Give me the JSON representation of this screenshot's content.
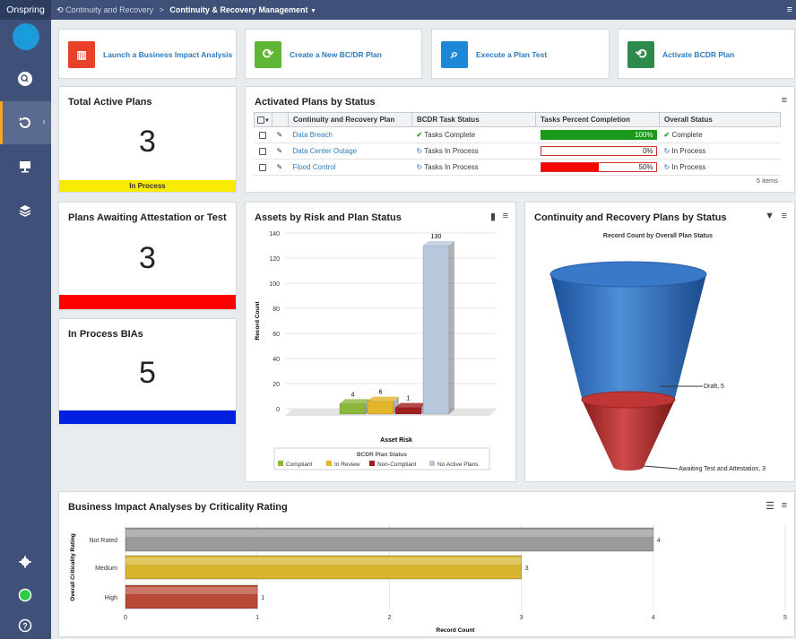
{
  "app": {
    "logo": "Onspring"
  },
  "breadcrumb": {
    "parent": "Continuity and Recovery",
    "separator": ">",
    "current": "Continuity & Recovery Management"
  },
  "nav": {
    "items": [
      "search-icon",
      "continuity-icon",
      "presentation-icon",
      "layers-icon",
      "gear-icon",
      "status-icon",
      "help-icon"
    ]
  },
  "actions": [
    {
      "label": "Launch a Business Impact Analysis",
      "color": "#e8402a"
    },
    {
      "label": "Create a New BC/DR Plan",
      "color": "#5fb534"
    },
    {
      "label": "Execute a Plan Test",
      "color": "#1e87d6"
    },
    {
      "label": "Activate BCDR Plan",
      "color": "#2e8a4a"
    }
  ],
  "stats": {
    "total_active": {
      "title": "Total Active Plans",
      "value": "3",
      "bar_label": "In Process",
      "bar_color": "#f7ec00"
    },
    "awaiting": {
      "title": "Plans Awaiting Attestation or Test",
      "value": "3",
      "bar_color": "#ff0000"
    },
    "bias": {
      "title": "In Process BIAs",
      "value": "5",
      "bar_color": "#0020e0"
    }
  },
  "plans_table": {
    "title": "Activated Plans by Status",
    "columns": [
      "Continuity and Recovery Plan",
      "BCDR Task Status",
      "Tasks Percent Completion",
      "Overall Status"
    ],
    "rows": [
      {
        "plan": "Data Breach",
        "task_status": "Tasks Complete",
        "percent": 100,
        "percent_label": "100%",
        "overall": "Complete",
        "bar_color": "#1a9a1a"
      },
      {
        "plan": "Data Center Outage",
        "task_status": "Tasks In Process",
        "percent": 0,
        "percent_label": "0%",
        "overall": "In Process",
        "bar_color": "#ff0000"
      },
      {
        "plan": "Flood Control",
        "task_status": "Tasks In Process",
        "percent": 50,
        "percent_label": "50%",
        "overall": "In Process",
        "bar_color": "#ff0000"
      }
    ],
    "footer": "5 items"
  },
  "chart_data": [
    {
      "type": "bar",
      "title": "Assets by Risk and Plan Status",
      "xlabel": "Asset Risk",
      "ylabel": "Record Count",
      "ylim": [
        0,
        140
      ],
      "yticks": [
        "0",
        "20",
        "40",
        "60",
        "80",
        "100",
        "120",
        "140"
      ],
      "legend_title": "BCDR Plan Status",
      "legend_position": "bottom",
      "series": [
        {
          "name": "Compliant",
          "values": [
            4
          ],
          "color": "#8bb83a"
        },
        {
          "name": "In Review",
          "values": [
            6
          ],
          "color": "#e3b52a"
        },
        {
          "name": "Non-Compliant",
          "values": [
            1
          ],
          "color": "#a01e1e"
        },
        {
          "name": "No Active Plans",
          "values": [
            130
          ],
          "color": "#b8c8dc"
        }
      ]
    },
    {
      "type": "funnel",
      "title": "Continuity and Recovery Plans by Status",
      "subtitle": "Record Count by Overall Plan Status",
      "segments": [
        {
          "label": "Draft, 5",
          "value": 5,
          "color": "#2e6fc0"
        },
        {
          "label": "Awaiting Test and Attestation, 3",
          "value": 3,
          "color": "#b02a2a"
        }
      ]
    },
    {
      "type": "bar",
      "orientation": "horizontal",
      "title": "Business Impact Analyses by Criticality Rating",
      "xlabel": "Record Count",
      "ylabel": "Overall Criticality Rating",
      "xlim": [
        0,
        5
      ],
      "xticks": [
        "0",
        "1",
        "2",
        "3",
        "4",
        "5"
      ],
      "categories": [
        "Not Rated",
        "Medium",
        "High"
      ],
      "values": [
        4,
        3,
        1
      ],
      "value_labels": [
        "4",
        "3",
        "1"
      ],
      "colors": [
        "#9a9a9a",
        "#d9b42e",
        "#b84a36"
      ]
    }
  ]
}
